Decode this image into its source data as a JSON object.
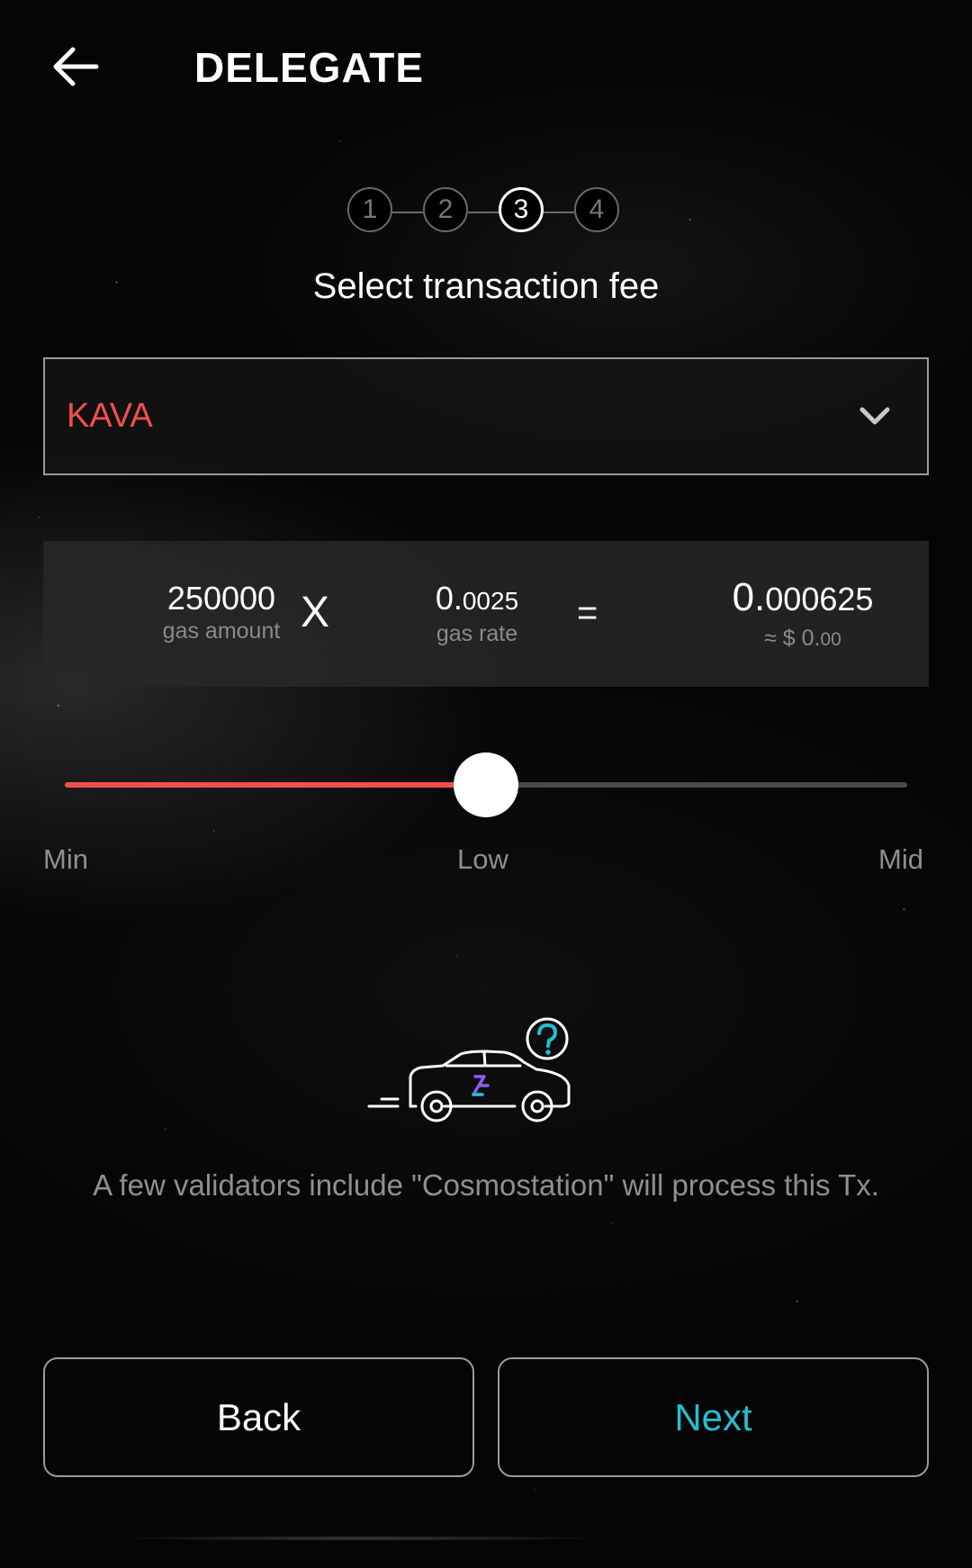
{
  "header": {
    "title": "DELEGATE",
    "back_icon": "arrow-left-icon"
  },
  "stepper": {
    "steps": [
      "1",
      "2",
      "3",
      "4"
    ],
    "active_step": 3
  },
  "step_title": "Select transaction fee",
  "fee_denom": {
    "selected": "KAVA",
    "chevron_icon": "chevron-down-icon",
    "color": "#f0504c"
  },
  "fee": {
    "gas_amount": "250000",
    "gas_amount_label": "gas amount",
    "multiply_symbol": "X",
    "gas_rate_int": "0.",
    "gas_rate_dec": "0025",
    "gas_rate_label": "gas rate",
    "equals_symbol": "=",
    "total_int": "0.",
    "total_dec": "000625",
    "usd_prefix": "≈ $ 0.",
    "usd_dec": "00"
  },
  "slider": {
    "labels": [
      "Min",
      "Low",
      "Mid"
    ],
    "value_fraction": 0.5,
    "fill_color": "#f0504c"
  },
  "illustration": {
    "icon": "car-with-question-icon"
  },
  "info_text": "A few validators include \"Cosmostation\" will process this Tx.",
  "buttons": {
    "back_label": "Back",
    "next_label": "Next",
    "next_color": "#22bfd1"
  }
}
